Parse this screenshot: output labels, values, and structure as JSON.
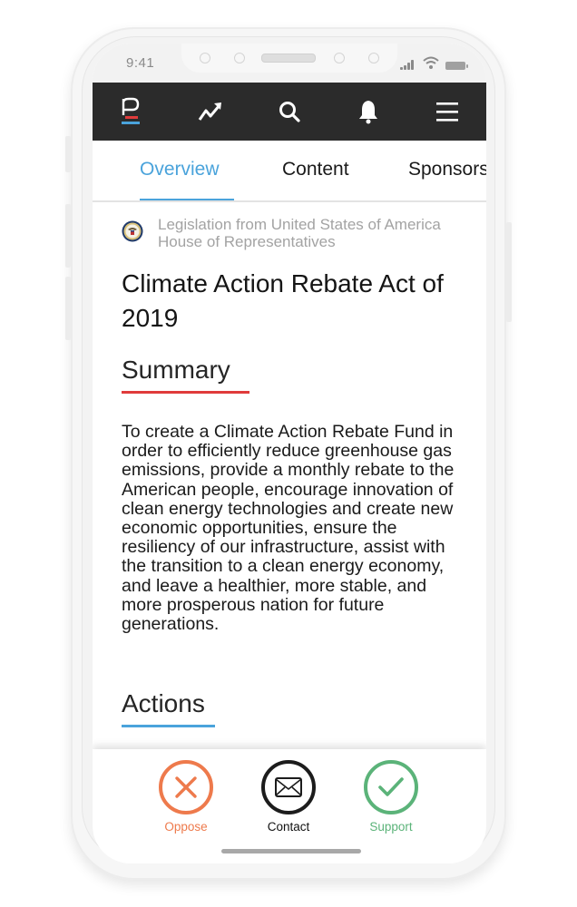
{
  "status_bar": {
    "time": "9:41",
    "icons": [
      "signal-icon",
      "wifi-icon",
      "battery-icon"
    ]
  },
  "nav": {
    "items": [
      {
        "name": "logo",
        "icon": "p-logo-icon"
      },
      {
        "name": "trending",
        "icon": "trending-up-icon"
      },
      {
        "name": "search",
        "icon": "search-icon"
      },
      {
        "name": "notifications",
        "icon": "bell-icon"
      },
      {
        "name": "menu",
        "icon": "hamburger-menu-icon"
      }
    ]
  },
  "tabs": [
    {
      "label": "Overview",
      "active": true
    },
    {
      "label": "Content",
      "active": false
    },
    {
      "label": "Sponsors",
      "active": false
    }
  ],
  "bill": {
    "source_icon": "house-seal-icon",
    "source": "Legislation from United States of America House of Representatives",
    "title": "Climate Action Rebate Act of 2019"
  },
  "sections": {
    "summary": {
      "heading": "Summary",
      "text": "To create a Climate Action Rebate Fund in order to efficiently reduce greenhouse gas emissions, provide a monthly rebate to the American people, encourage innovation of clean energy technologies and create new economic opportunities, ensure the resiliency of our infrastructure, assist with the transition to a clean energy economy, and leave a healthier, more stable, and more prosperous nation for future generations."
    },
    "actions": {
      "heading": "Actions"
    }
  },
  "action_bar": {
    "oppose": {
      "label": "Oppose",
      "icon": "x-circle-icon",
      "color": "#ee7a4c"
    },
    "contact": {
      "label": "Contact",
      "icon": "envelope-icon",
      "color": "#1c1c1c"
    },
    "support": {
      "label": "Support",
      "icon": "check-circle-icon",
      "color": "#5bb379"
    }
  },
  "colors": {
    "accent_blue": "#4aa3db",
    "accent_red": "#e03b3b",
    "nav_bg": "#2b2b2b"
  }
}
